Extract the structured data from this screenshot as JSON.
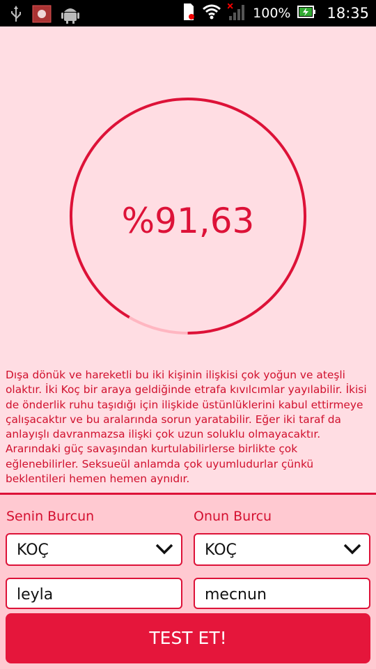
{
  "status_bar": {
    "battery_percent_label": "100%",
    "time": "18:35"
  },
  "gauge": {
    "percent_text": "%91,63",
    "fill_fraction": 0.9163
  },
  "description": "Dışa dönük ve hareketli bu iki kişinin ilişkisi çok yoğun ve ateşli olaktır. İki Koç bir araya geldiğinde etrafa kıvılcımlar yayılabilir. İkisi de önderlik ruhu taşıdığı için ilişkide üstünlüklerini kabul ettirmeye çalışacaktır ve bu aralarında sorun yaratabilir. Eğer iki taraf da anlayışlı davranmazsa ilişki çok uzun soluklu olmayacaktır. Ararındaki güç savaşından kurtulabilirlerse birlikte çok eğlenebilirler. Seksueül anlamda çok uyumludurlar çünkü beklentileri hemen hemen aynıdır.",
  "form": {
    "your_sign_label": "Senin Burcun",
    "their_sign_label": "Onun Burcu",
    "your_sign_value": "KOÇ",
    "their_sign_value": "KOÇ",
    "your_name": "leyla",
    "their_name": "mecnun",
    "button_label": "TEST ET!"
  },
  "colors": {
    "accent": "#dd1238",
    "background": "#ffdde3",
    "track": "#ffb6c1"
  }
}
